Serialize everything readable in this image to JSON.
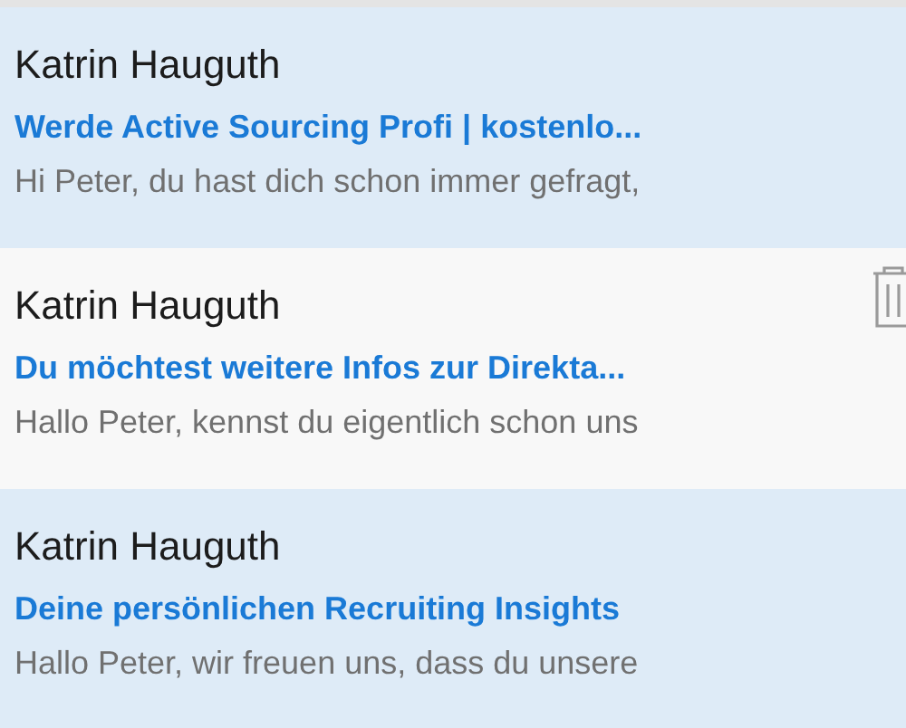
{
  "messages": [
    {
      "sender": "Katrin Hauguth",
      "subject": "Werde Active Sourcing Profi | kostenlo...",
      "preview": "Hi Peter, du hast dich schon immer gefragt,",
      "unread": true,
      "show_delete": false
    },
    {
      "sender": "Katrin Hauguth",
      "subject": "Du möchtest weitere Infos zur Direkta...",
      "preview": "Hallo Peter, kennst du eigentlich schon uns",
      "unread": false,
      "show_delete": true
    },
    {
      "sender": "Katrin Hauguth",
      "subject": "Deine persönlichen Recruiting Insights",
      "preview": "Hallo Peter, wir freuen uns, dass du unsere",
      "unread": true,
      "show_delete": false
    }
  ]
}
